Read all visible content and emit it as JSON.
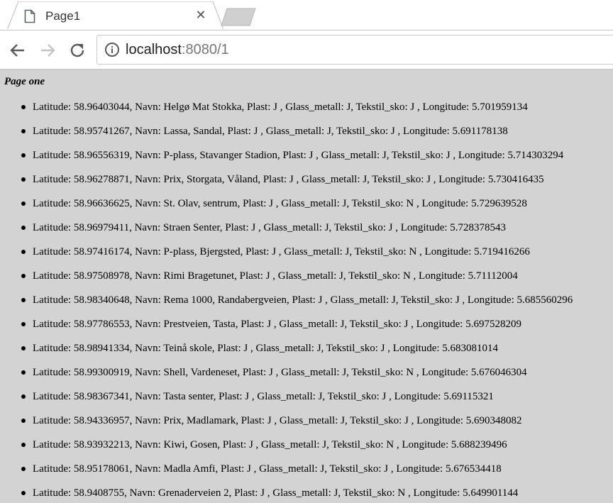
{
  "browser": {
    "tab_title": "Page1",
    "close_glyph": "✕",
    "url_host": "localhost",
    "url_rest": ":8080/1"
  },
  "page": {
    "heading": "Page one",
    "items": [
      "Latitude: 58.96403044, Navn: Helgø Mat Stokka, Plast: J , Glass_metall: J, Tekstil_sko: J , Longitude: 5.701959134",
      "Latitude: 58.95741267, Navn: Lassa, Sandal, Plast: J , Glass_metall: J, Tekstil_sko: J , Longitude: 5.691178138",
      "Latitude: 58.96556319, Navn: P-plass, Stavanger Stadion, Plast: J , Glass_metall: J, Tekstil_sko: J , Longitude: 5.714303294",
      "Latitude: 58.96278871, Navn: Prix, Storgata, Våland, Plast: J , Glass_metall: J, Tekstil_sko: J , Longitude: 5.730416435",
      "Latitude: 58.96636625, Navn: St. Olav, sentrum, Plast: J , Glass_metall: J, Tekstil_sko: N , Longitude: 5.729639528",
      "Latitude: 58.96979411, Navn: Straen Senter, Plast: J , Glass_metall: J, Tekstil_sko: J , Longitude: 5.728378543",
      "Latitude: 58.97416174, Navn: P-plass, Bjergsted, Plast: J , Glass_metall: J, Tekstil_sko: N , Longitude: 5.719416266",
      "Latitude: 58.97508978, Navn: Rimi Bragetunet, Plast: J , Glass_metall: J, Tekstil_sko: N , Longitude: 5.71112004",
      "Latitude: 58.98340648, Navn: Rema 1000, Randabergveien, Plast: J , Glass_metall: J, Tekstil_sko: J , Longitude: 5.685560296",
      "Latitude: 58.97786553, Navn: Prestveien, Tasta, Plast: J , Glass_metall: J, Tekstil_sko: J , Longitude: 5.697528209",
      "Latitude: 58.98941334, Navn: Teinå skole, Plast: J , Glass_metall: J, Tekstil_sko: J , Longitude: 5.683081014",
      "Latitude: 58.99300919, Navn: Shell, Vardeneset, Plast: J , Glass_metall: J, Tekstil_sko: N , Longitude: 5.676046304",
      "Latitude: 58.98367341, Navn: Tasta senter, Plast: J , Glass_metall: J, Tekstil_sko: J , Longitude: 5.69115321",
      "Latitude: 58.94336957, Navn: Prix, Madlamark, Plast: J , Glass_metall: J, Tekstil_sko: J , Longitude: 5.690348082",
      "Latitude: 58.93932213, Navn: Kiwi, Gosen, Plast: J , Glass_metall: J, Tekstil_sko: N , Longitude: 5.688239496",
      "Latitude: 58.95178061, Navn: Madla Amfi, Plast: J , Glass_metall: J, Tekstil_sko: J , Longitude: 5.676534418",
      "Latitude: 58.9408755, Navn: Grenaderveien 2, Plast: J , Glass_metall: J, Tekstil_sko: N , Longitude: 5.649901144"
    ]
  },
  "icons": {
    "tab_favicon": "document-icon",
    "back": "back-arrow-icon",
    "forward": "forward-arrow-icon",
    "reload": "reload-icon",
    "site_info": "info-icon",
    "tab_close": "close-icon"
  },
  "colors": {
    "page_background": "#d3d3d3",
    "chrome_background": "#ffffff"
  }
}
